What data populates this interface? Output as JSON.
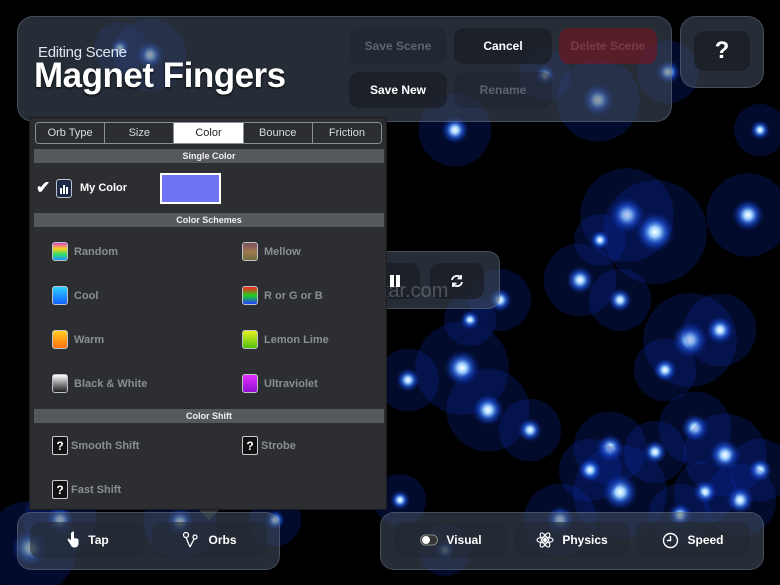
{
  "header": {
    "editing_label": "Editing Scene",
    "scene_title": "Magnet Fingers",
    "buttons": {
      "save_scene": "Save Scene",
      "cancel": "Cancel",
      "delete_scene": "Delete Scene",
      "save_new": "Save New",
      "rename": "Rename"
    },
    "help_label": "?"
  },
  "orb_panel": {
    "tabs": [
      "Orb Type",
      "Size",
      "Color",
      "Bounce",
      "Friction"
    ],
    "active_tab": "Color",
    "single_color": {
      "header": "Single Color",
      "my_color_label": "My Color",
      "my_color_value": "#6f73f5",
      "checked": true
    },
    "color_schemes": {
      "header": "Color Schemes",
      "items": [
        "Random",
        "Mellow",
        "Cool",
        "R or G or B",
        "Warm",
        "Lemon Lime",
        "Black & White",
        "Ultraviolet"
      ]
    },
    "color_shift": {
      "header": "Color Shift",
      "items": [
        "Smooth Shift",
        "Strobe",
        "Fast Shift"
      ],
      "icon_glyph": "?"
    }
  },
  "watermark": "UpdateStar.com",
  "bottom_left": {
    "tap": "Tap",
    "orbs": "Orbs"
  },
  "bottom_right": {
    "visual": "Visual",
    "physics": "Physics",
    "speed": "Speed"
  }
}
